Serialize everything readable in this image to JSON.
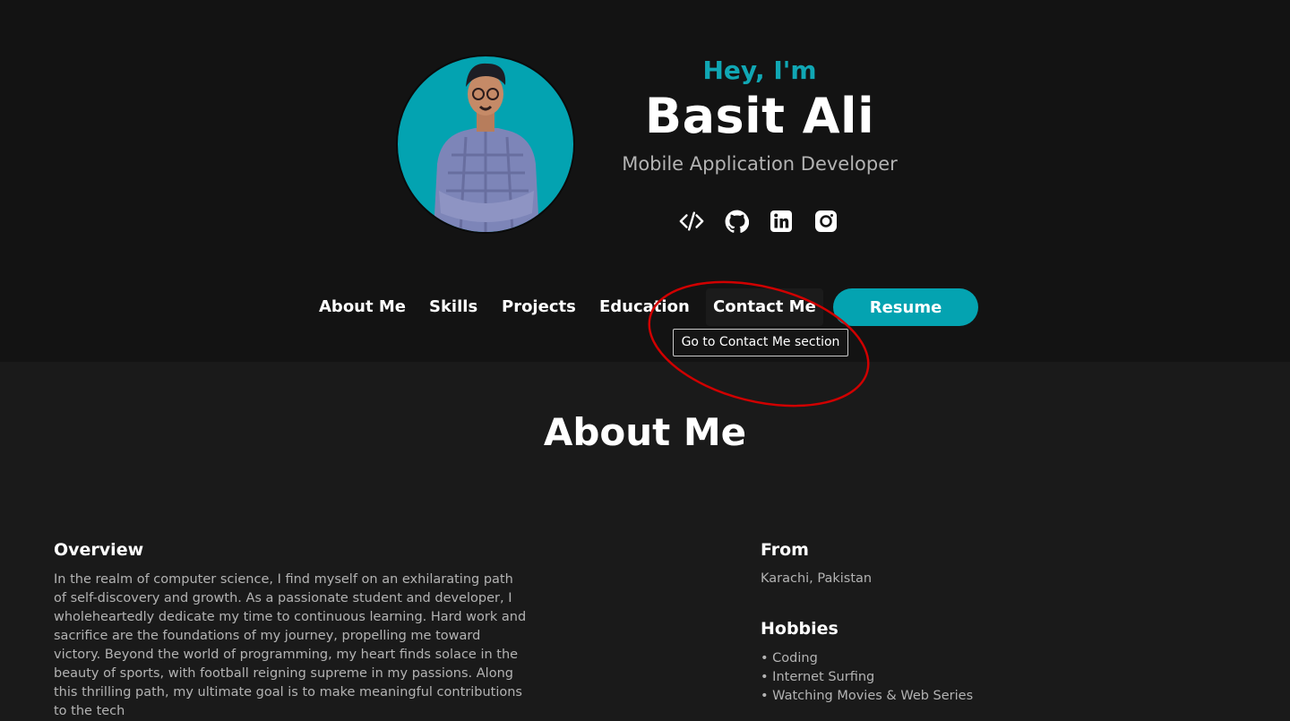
{
  "hero": {
    "greeting": "Hey, I'm",
    "name": "Basit Ali",
    "role": "Mobile Application Developer",
    "socials": [
      "code-icon",
      "github-icon",
      "linkedin-icon",
      "instagram-icon"
    ]
  },
  "nav": {
    "items": [
      "About Me",
      "Skills",
      "Projects",
      "Education",
      "Contact Me"
    ],
    "resume_label": "Resume",
    "tooltip": "Go to Contact Me section"
  },
  "about": {
    "title": "About Me",
    "overview_heading": "Overview",
    "overview_text": "In the realm of computer science, I find myself on an exhilarating path of self-discovery and growth. As a passionate student and developer, I wholeheartedly dedicate my time to continuous learning. Hard work and sacrifice are the foundations of my journey, propelling me toward victory. Beyond the world of programming, my heart finds solace in the beauty of sports, with football reigning supreme in my passions. Along this thrilling path, my ultimate goal is to make meaningful contributions to the tech",
    "from_heading": "From",
    "from_value": "Karachi, Pakistan",
    "hobbies_heading": "Hobbies",
    "hobbies": [
      "• Coding",
      "• Internet Surfing",
      "• Watching Movies & Web Series"
    ]
  },
  "colors": {
    "accent": "#04a3b1",
    "header_bg": "#131313",
    "body_bg": "#1a1a1a",
    "annotation": "#d00000"
  }
}
